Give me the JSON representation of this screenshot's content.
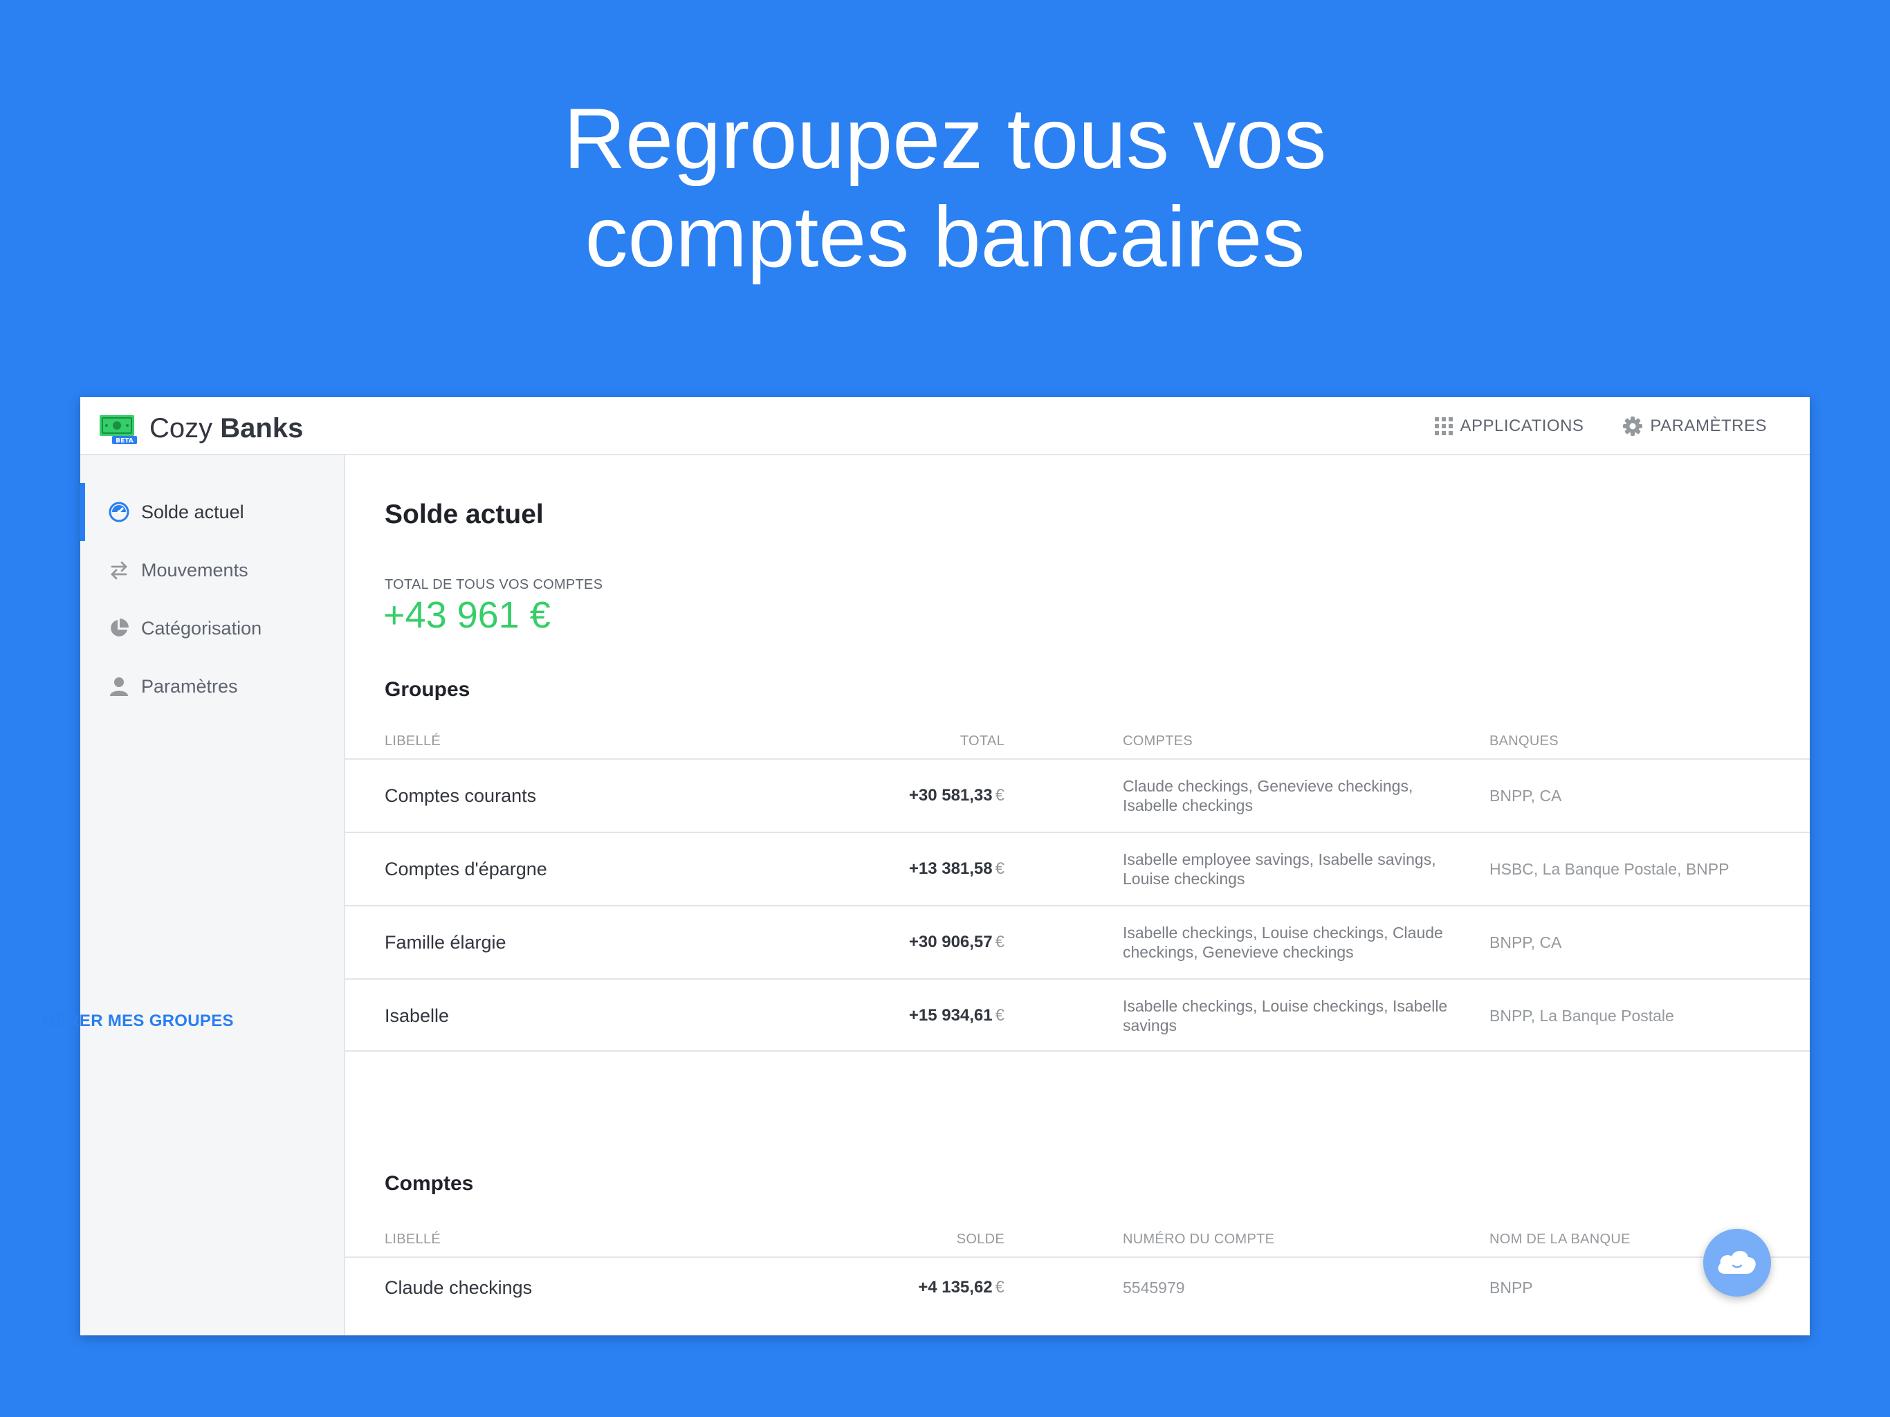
{
  "hero": {
    "line1": "Regroupez tous vos",
    "line2": "comptes bancaires"
  },
  "app": {
    "brand_light": "Cozy",
    "brand_bold": "Banks",
    "beta": "BETA"
  },
  "topnav": {
    "applications": "APPLICATIONS",
    "settings": "PARAMÈTRES"
  },
  "sidebar": {
    "items": [
      {
        "label": "Solde actuel",
        "icon": "gauge-icon",
        "active": true
      },
      {
        "label": "Mouvements",
        "icon": "transfer-arrows-icon",
        "active": false
      },
      {
        "label": "Catégorisation",
        "icon": "pie-chart-icon",
        "active": false
      },
      {
        "label": "Paramètres",
        "icon": "user-icon",
        "active": false
      }
    ]
  },
  "main": {
    "title": "Solde actuel",
    "total_label": "TOTAL DE TOUS VOS COMPTES",
    "total_value": "+43 961 €",
    "groups": {
      "title": "Groupes",
      "headers": {
        "label": "LIBELLÉ",
        "total": "TOTAL",
        "accounts": "COMPTES",
        "banks": "BANQUES"
      },
      "rows": [
        {
          "name": "Comptes courants",
          "total": "+30 581,33",
          "currency": "€",
          "accounts": "Claude checkings, Genevieve checkings, Isabelle checkings",
          "banks": "BNPP, CA"
        },
        {
          "name": "Comptes d'épargne",
          "total": "+13 381,58",
          "currency": "€",
          "accounts": "Isabelle employee savings, Isabelle savings, Louise checkings",
          "banks": "HSBC, La Banque Postale, BNPP"
        },
        {
          "name": "Famille élargie",
          "total": "+30 906,57",
          "currency": "€",
          "accounts": "Isabelle checkings, Louise checkings, Claude checkings, Genevieve checkings",
          "banks": "BNPP, CA"
        },
        {
          "name": "Isabelle",
          "total": "+15 934,61",
          "currency": "€",
          "accounts": "Isabelle checkings, Louise checkings, Isabelle savings",
          "banks": "BNPP, La Banque Postale"
        }
      ],
      "manage_label": "GÉRER MES GROUPES"
    },
    "accounts": {
      "title": "Comptes",
      "headers": {
        "label": "LIBELLÉ",
        "balance": "SOLDE",
        "number": "NUMÉRO DU COMPTE",
        "bank": "NOM DE LA BANQUE"
      },
      "rows": [
        {
          "name": "Claude checkings",
          "balance": "+4 135,62",
          "currency": "€",
          "number": "5545979",
          "bank": "BNPP"
        }
      ]
    }
  },
  "colors": {
    "background": "#2b80f2",
    "accent": "#297ef2",
    "positive": "#35ce68"
  }
}
